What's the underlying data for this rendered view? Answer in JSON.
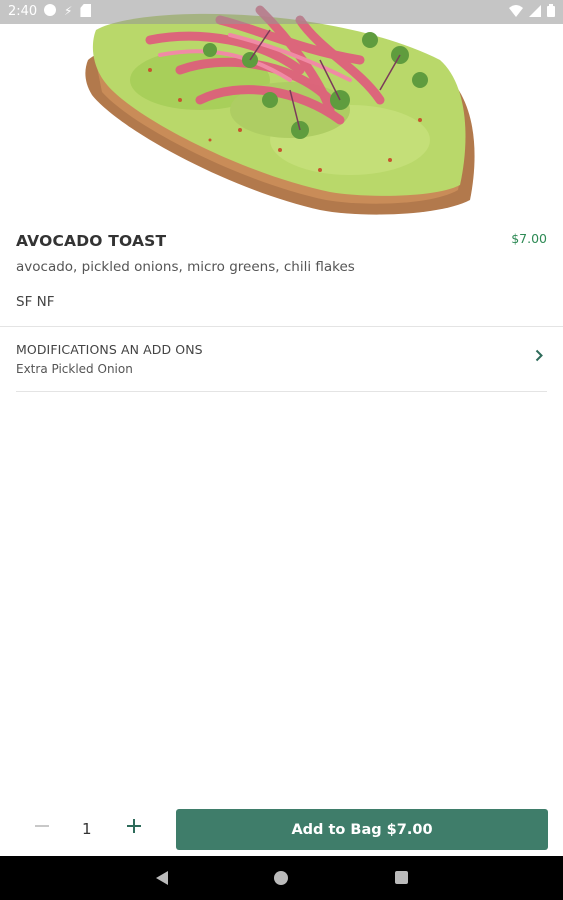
{
  "status_bar": {
    "time": "2:40"
  },
  "item": {
    "title": "AVOCADO TOAST",
    "price": "$7.00",
    "description": "avocado, pickled onions, micro greens, chili flakes",
    "tags": "SF NF"
  },
  "modifications": {
    "label": "MODIFICATIONS AN ADD ONS",
    "value": "Extra Pickled Onion"
  },
  "cart": {
    "quantity": "1",
    "add_button_label": "Add to Bag $7.00"
  },
  "colors": {
    "accent": "#3f7d6a",
    "price": "#2e8a55",
    "stepper": "#2e6b5a"
  }
}
